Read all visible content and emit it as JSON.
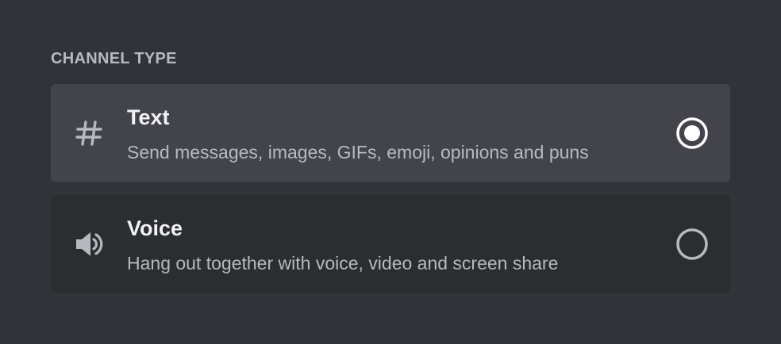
{
  "section": {
    "title": "CHANNEL TYPE"
  },
  "options": [
    {
      "label": "Text",
      "description": "Send messages, images, GIFs, emoji, opinions and puns",
      "icon": "hashtag-icon",
      "selected": true
    },
    {
      "label": "Voice",
      "description": "Hang out together with voice, video and screen share",
      "icon": "speaker-icon",
      "selected": false
    }
  ],
  "colors": {
    "background": "#313338",
    "selected_row": "#43444b",
    "unselected_row": "#2b2d31",
    "icon": "#b5bac1",
    "radio_selected": "#ffffff",
    "radio_unselected": "#b5bac1"
  }
}
